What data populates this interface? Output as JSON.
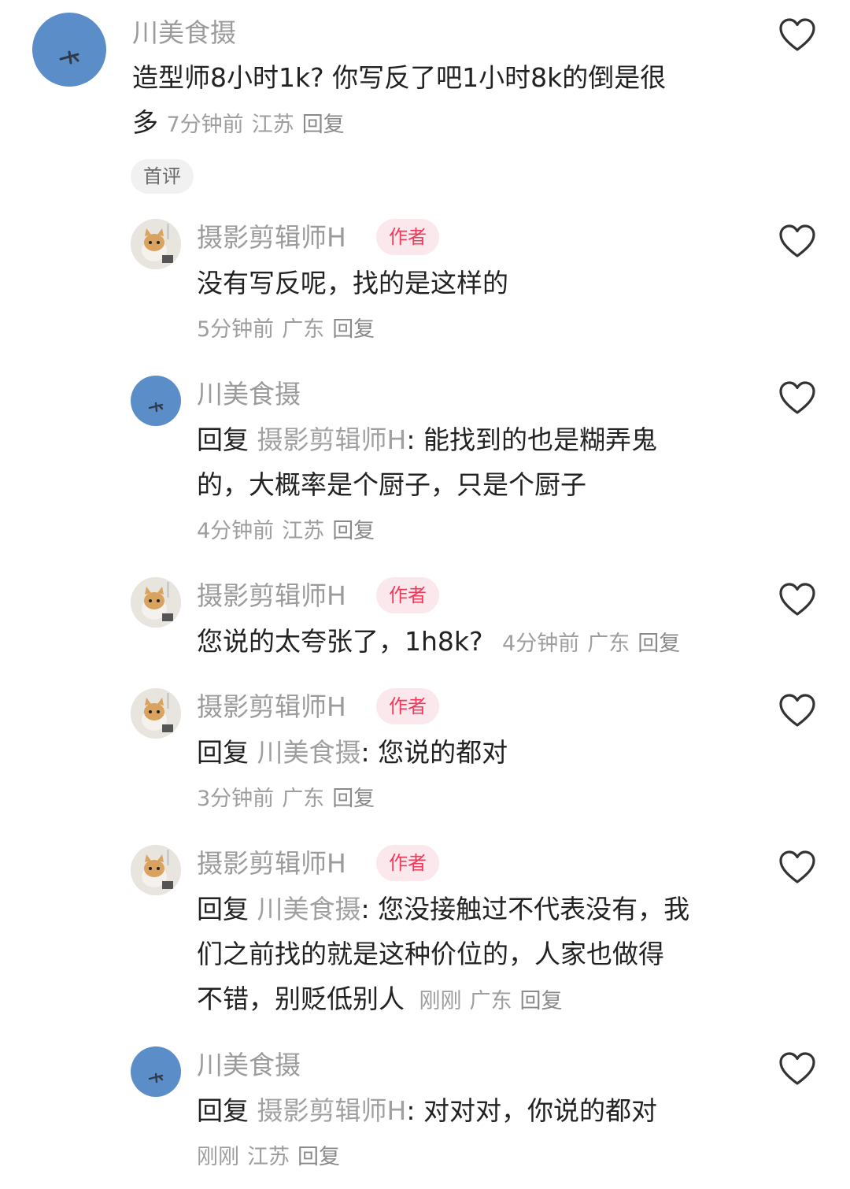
{
  "c1": {
    "user": "川美食摄",
    "text_line1": "造型师8小时1k? 你写反了吧1小时8k的倒是很",
    "text_line2": "多",
    "time": "7分钟前",
    "loc": "江苏",
    "reply": "回复",
    "tag": "首评"
  },
  "r1": {
    "user": "摄影剪辑师H",
    "badge": "作者",
    "text": "没有写反呢，找的是这样的",
    "time": "5分钟前",
    "loc": "广东",
    "reply": "回复"
  },
  "r2": {
    "user": "川美食摄",
    "prefix": "回复",
    "ref": "摄影剪辑师H",
    "colon": ":",
    "text_line1": " 能找到的也是糊弄鬼",
    "text_line2": "的，大概率是个厨子，只是个厨子",
    "time": "4分钟前",
    "loc": "江苏",
    "reply": "回复"
  },
  "r3": {
    "user": "摄影剪辑师H",
    "badge": "作者",
    "text": "您说的太夸张了，1h8k?",
    "time": "4分钟前",
    "loc": "广东",
    "reply": "回复"
  },
  "r4": {
    "user": "摄影剪辑师H",
    "badge": "作者",
    "prefix": "回复",
    "ref": "川美食摄",
    "colon": ":",
    "text": " 您说的都对",
    "time": "3分钟前",
    "loc": "广东",
    "reply": "回复"
  },
  "r5": {
    "user": "摄影剪辑师H",
    "badge": "作者",
    "prefix": "回复",
    "ref": "川美食摄",
    "colon": ":",
    "text_line1": " 您没接触过不代表没有，我",
    "text_line2": "们之前找的就是这种价位的，人家也做得",
    "text_line3": "不错，别贬低别人",
    "time": "刚刚",
    "loc": "广东",
    "reply": "回复"
  },
  "r6": {
    "user": "川美食摄",
    "prefix": "回复",
    "ref": "摄影剪辑师H",
    "colon": ":",
    "text": " 对对对，你说的都对",
    "time": "刚刚",
    "loc": "江苏",
    "reply": "回复"
  },
  "icons": {
    "like": "heart-outline-icon"
  },
  "colors": {
    "author_badge_bg": "#fbe8ec",
    "author_badge_text": "#ef3a5a",
    "avatar_blue": "#5b8ec8"
  }
}
